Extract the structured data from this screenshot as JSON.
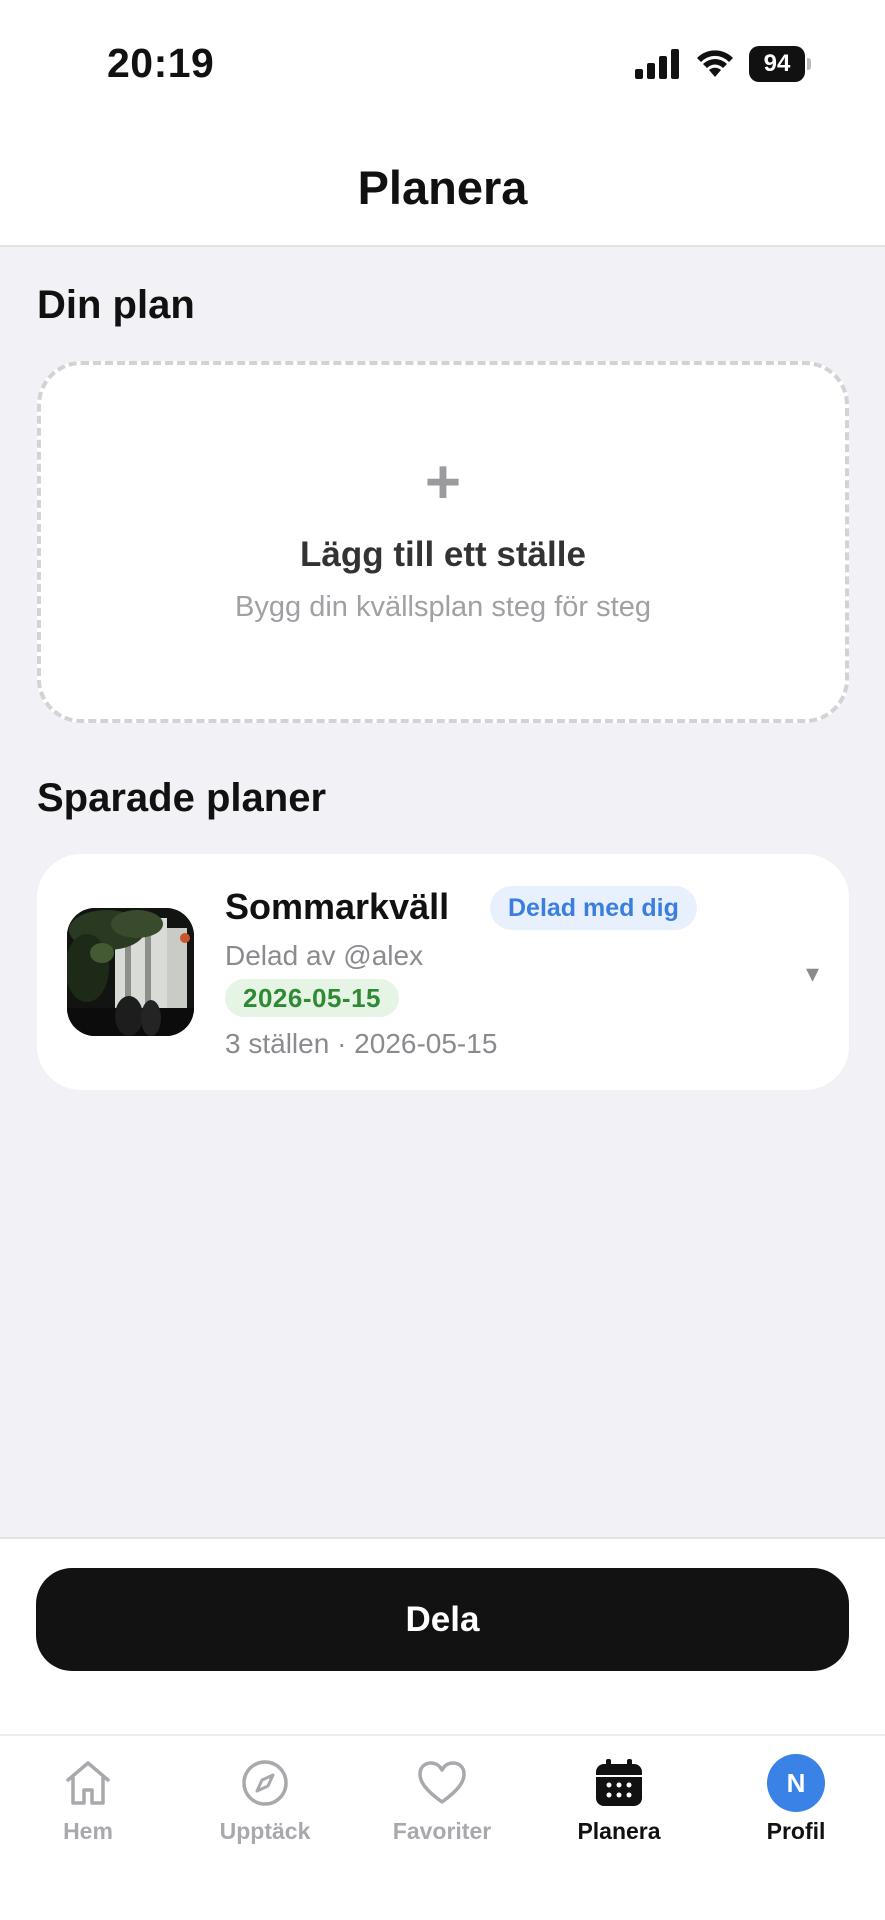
{
  "status_bar": {
    "time": "20:19",
    "battery": "94"
  },
  "header": {
    "title": "Planera"
  },
  "plan_section": {
    "heading": "Din plan",
    "add_card": {
      "icon": "plus-icon",
      "title": "Lägg till ett ställe",
      "subtitle": "Bygg din kvällsplan steg för steg"
    }
  },
  "saved_section": {
    "heading": "Sparade planer",
    "plans": [
      {
        "name": "Sommarkväll",
        "badge": "Delad med dig",
        "shared_by": "Delad av @alex",
        "date_badge": "2026-05-15",
        "meta": "3 ställen · 2026-05-15",
        "expand_icon": "▾"
      }
    ]
  },
  "share_button": {
    "label": "Dela"
  },
  "tabbar": {
    "tabs": [
      {
        "label": "Hem",
        "icon": "home-icon",
        "active": false
      },
      {
        "label": "Upptäck",
        "icon": "compass-icon",
        "active": false
      },
      {
        "label": "Favoriter",
        "icon": "heart-icon",
        "active": false
      },
      {
        "label": "Planera",
        "icon": "calendar-icon",
        "active": true
      },
      {
        "label": "Profil",
        "icon": "avatar",
        "avatar_initial": "N",
        "active": false
      }
    ]
  },
  "colors": {
    "background": "#f1f1f6",
    "accent_blue": "#3a82e6",
    "badge_blue_text": "#3a7fe0",
    "badge_green_text": "#2f8a33",
    "primary_button": "#121212"
  }
}
